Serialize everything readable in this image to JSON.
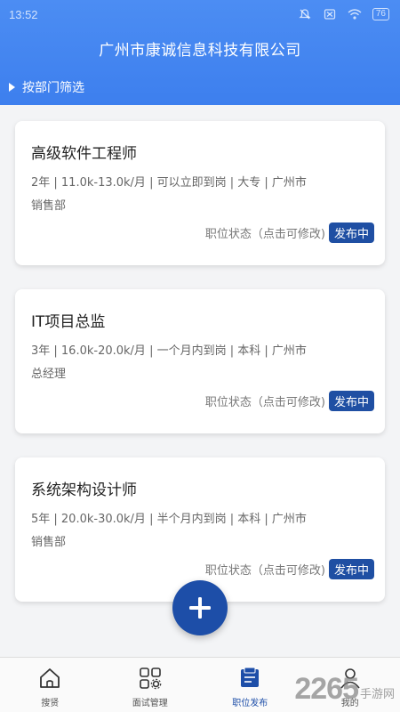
{
  "status_bar": {
    "time": "13:52",
    "battery": "76"
  },
  "header": {
    "title": "广州市康诚信息科技有限公司",
    "filter_label": "按部门筛选"
  },
  "jobs": [
    {
      "title": "高级软件工程师",
      "meta": "2年 | 11.0k-13.0k/月 | 可以立即到岗 | 大专 | 广州市",
      "dept": "销售部",
      "status_label": "职位状态（点击可修改)",
      "status": "发布中"
    },
    {
      "title": "IT项目总监",
      "meta": "3年 | 16.0k-20.0k/月 | 一个月内到岗 | 本科 | 广州市",
      "dept": "总经理",
      "status_label": "职位状态（点击可修改)",
      "status": "发布中"
    },
    {
      "title": "系统架构设计师",
      "meta": "5年 | 20.0k-30.0k/月 | 半个月内到岗 | 本科 | 广州市",
      "dept": "销售部",
      "status_label": "职位状态（点击可修改)",
      "status": "发布中"
    }
  ],
  "tabs": [
    {
      "label": "搜贤",
      "icon": "home-icon"
    },
    {
      "label": "面试管理",
      "icon": "grid-gear-icon"
    },
    {
      "label": "职位发布",
      "icon": "briefcase-icon"
    },
    {
      "label": "我的",
      "icon": "profile-icon"
    }
  ],
  "active_tab": 2,
  "watermark": {
    "number": "2265",
    "text": "手游网"
  },
  "colors": {
    "header": "#4c8df3",
    "accent": "#1d4ea8",
    "pill": "#1f4fa3"
  }
}
